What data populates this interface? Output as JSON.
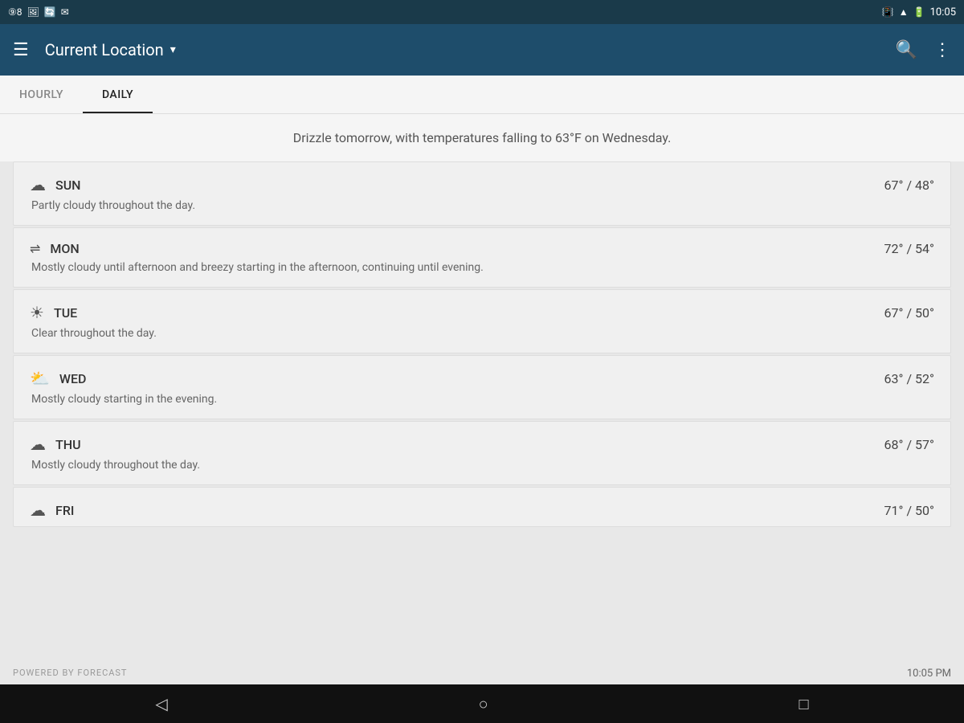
{
  "statusBar": {
    "time": "10:05",
    "icons": [
      "notification-98",
      "image",
      "sync",
      "message"
    ]
  },
  "appBar": {
    "menuLabel": "☰",
    "title": "Current Location",
    "dropdownIcon": "▾",
    "searchIcon": "search",
    "moreIcon": "⋮"
  },
  "tabs": [
    {
      "id": "hourly",
      "label": "HOURLY",
      "active": false
    },
    {
      "id": "daily",
      "label": "DAILY",
      "active": true
    }
  ],
  "summary": "Drizzle tomorrow, with temperatures falling to 63°F on Wednesday.",
  "forecast": [
    {
      "day": "SUN",
      "icon": "partly-cloudy",
      "iconChar": "☁",
      "temp": "67° / 48°",
      "description": "Partly cloudy throughout the day."
    },
    {
      "day": "MON",
      "icon": "wind",
      "iconChar": "⇌",
      "temp": "72° / 54°",
      "description": "Mostly cloudy until afternoon and breezy starting in the afternoon, continuing until evening."
    },
    {
      "day": "TUE",
      "icon": "clear",
      "iconChar": "☀",
      "temp": "67° / 50°",
      "description": "Clear throughout the day."
    },
    {
      "day": "WED",
      "icon": "cloudy",
      "iconChar": "⛅",
      "temp": "63° / 52°",
      "description": "Mostly cloudy starting in the evening."
    },
    {
      "day": "THU",
      "icon": "partly-cloudy",
      "iconChar": "☁",
      "temp": "68° / 57°",
      "description": "Mostly cloudy throughout the day."
    },
    {
      "day": "FRI",
      "icon": "partly-cloudy",
      "iconChar": "☁",
      "temp": "71° / 50°",
      "description": ""
    }
  ],
  "footer": {
    "poweredBy": "POWERED BY FORECAST",
    "time": "10:05 PM"
  },
  "navBar": {
    "backIcon": "◁",
    "homeIcon": "○",
    "recentIcon": "□"
  }
}
